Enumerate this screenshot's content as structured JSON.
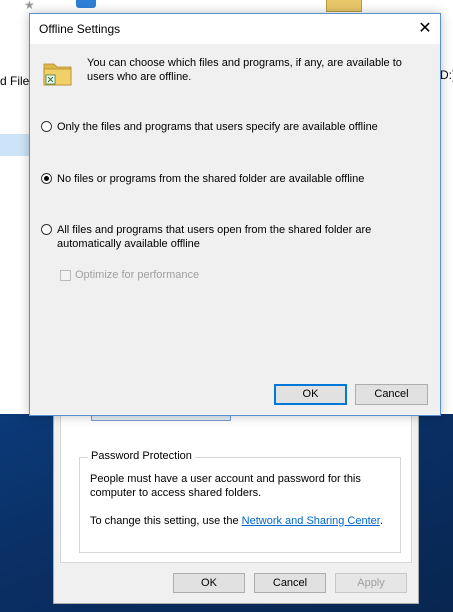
{
  "explorer": {
    "files_fragment": "d Files",
    "drive_fragment": "D:)"
  },
  "dialog": {
    "title": "Offline Settings",
    "close_glyph": "✕",
    "intro": "You can choose which files and programs, if any, are available to users who are offline.",
    "options": [
      {
        "label": "Only the files and programs that users specify are available offline",
        "selected": false
      },
      {
        "label": "No files or programs from the shared folder are available offline",
        "selected": true
      },
      {
        "label": "All files and programs that users open from the shared folder are automatically available offline",
        "selected": false
      }
    ],
    "optimize_label": "Optimize for performance",
    "optimize_checked": false,
    "optimize_enabled": false,
    "ok_label": "OK",
    "cancel_label": "Cancel"
  },
  "background_dialog": {
    "password_group_title": "Password Protection",
    "password_desc": "People must have a user account and password for this computer to access shared folders.",
    "change_prefix": "To change this setting, use the ",
    "change_link": "Network and Sharing Center",
    "change_suffix": ".",
    "ok_label": "OK",
    "cancel_label": "Cancel",
    "apply_label": "Apply"
  },
  "colors": {
    "accent": "#0078d7",
    "link": "#0066cc",
    "desktop": "#0a3066"
  }
}
